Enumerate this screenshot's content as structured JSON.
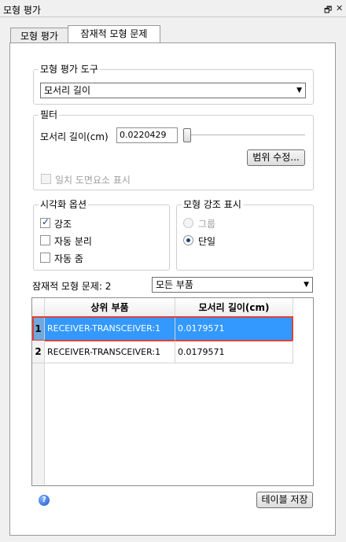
{
  "window": {
    "title": "모형 평가",
    "restore_icon": "restore-icon",
    "close_icon": "close-icon"
  },
  "tabs": [
    {
      "label": "모형 평가",
      "active": false
    },
    {
      "label": "잠재적 모형 문제",
      "active": true
    }
  ],
  "eval_tool": {
    "label": "모형 평가 도구",
    "selected": "모서리 길이"
  },
  "filter": {
    "label": "필터",
    "edge_label": "모서리 길이(cm)",
    "edge_value": "0.0220429",
    "slider_fraction": 0.0,
    "range_button": "범위 수정...",
    "coincident_label": "일치 도면요소 표시",
    "coincident_checked": false
  },
  "viz": {
    "label": "시각화 옵션",
    "highlight": "강조",
    "highlight_checked": true,
    "auto_isolate": "자동 분리",
    "auto_isolate_checked": false,
    "auto_zoom": "자동 줌",
    "auto_zoom_checked": false
  },
  "emphasis": {
    "label": "모형 강조 표시",
    "group": "그룹",
    "single": "단일",
    "selected": "single"
  },
  "problems": {
    "label": "잠재적 모형 문제: 2",
    "filter_selected": "모든 부품"
  },
  "table": {
    "columns": [
      "상위 부품",
      "모서리 길이(cm)"
    ],
    "rows": [
      {
        "index": "1",
        "parent": "RECEIVER-TRANSCEIVER:1",
        "edge": "0.0179571",
        "selected": true
      },
      {
        "index": "2",
        "parent": "RECEIVER-TRANSCEIVER:1",
        "edge": "0.0179571",
        "selected": false
      }
    ]
  },
  "footer": {
    "help_icon": "help-icon",
    "save_button": "테이블 저장"
  },
  "colors": {
    "selection": "#3399ff",
    "highlight_border": "#e0403a",
    "panel_border": "#9a9a9a"
  }
}
